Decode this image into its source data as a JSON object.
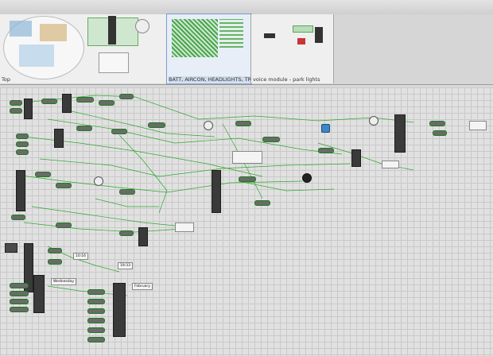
{
  "thumbnails": [
    {
      "label": "Top"
    },
    {
      "label": ""
    },
    {
      "label": "BATT, AIRCON, HEADLIGHTS, TR"
    },
    {
      "label": "voice module - park lights"
    }
  ],
  "canvas_nodes": [
    {
      "label": "Wednesday"
    },
    {
      "label": "February"
    },
    {
      "label": "10:16"
    },
    {
      "label": "19:33"
    }
  ],
  "colors": {
    "wire": "#1aa31a",
    "module": "#3a3a3a",
    "selected_tab": "#7a9cd0"
  }
}
